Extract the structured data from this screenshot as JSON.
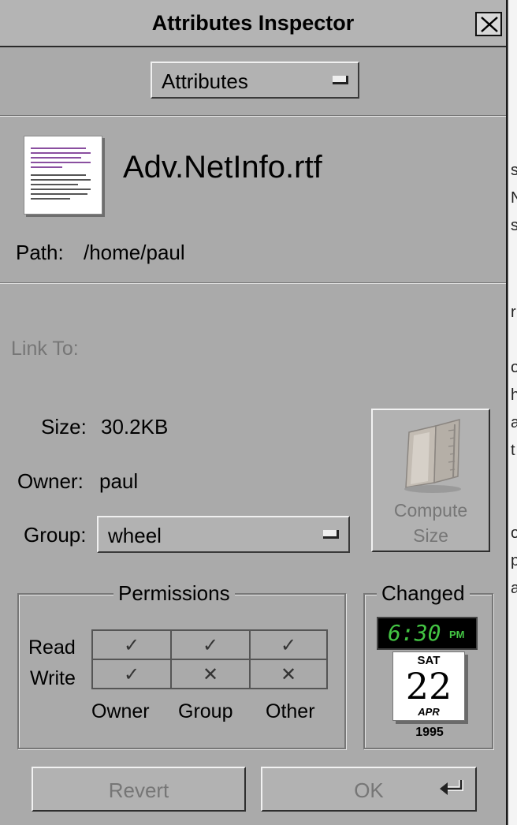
{
  "window": {
    "title": "Attributes Inspector"
  },
  "inspector_mode": {
    "selected": "Attributes"
  },
  "file": {
    "name": "Adv.NetInfo.rtf",
    "path_label": "Path:",
    "path": "/home/paul",
    "link_label": "Link To:"
  },
  "info": {
    "size_label": "Size:",
    "size": "30.2KB",
    "owner_label": "Owner:",
    "owner": "paul",
    "group_label": "Group:",
    "group": "wheel"
  },
  "compute_size": {
    "line1": "Compute",
    "line2": "Size"
  },
  "permissions": {
    "title": "Permissions",
    "rows": [
      "Read",
      "Write"
    ],
    "columns": [
      "Owner",
      "Group",
      "Other"
    ],
    "values": [
      [
        true,
        true,
        true
      ],
      [
        true,
        false,
        false
      ]
    ],
    "mark_allowed": "✓",
    "mark_denied": "✕"
  },
  "changed": {
    "title": "Changed",
    "time": "6:30",
    "ampm": "PM",
    "weekday": "SAT",
    "day": "22",
    "month": "APR",
    "year": "1995"
  },
  "buttons": {
    "revert": "Revert",
    "ok": "OK"
  },
  "colors": {
    "panel": "#aaaaaa",
    "clock_green": "#43c443",
    "disabled_text": "#767676"
  }
}
